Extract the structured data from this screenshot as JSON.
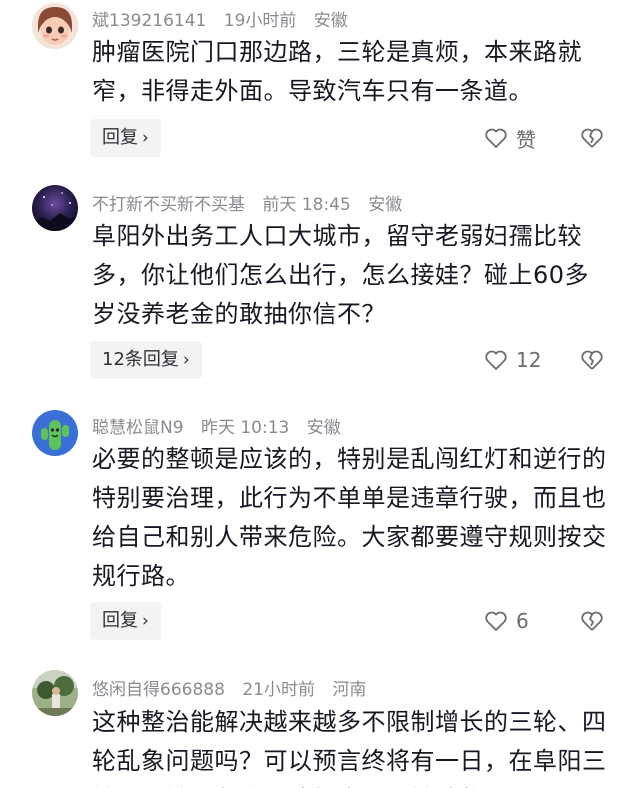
{
  "comments": [
    {
      "username": "斌139216141",
      "time": "19小时前",
      "location": "安徽",
      "text": "肿瘤医院门口那边路，三轮是真烦，本来路就窄，非得走外面。导致汽车只有一条道。",
      "reply_label": "回复",
      "like_label": "赞",
      "avatar_icon": "cartoon-girl-avatar"
    },
    {
      "username": "不打新不买新不买基",
      "time": "前天 18:45",
      "location": "安徽",
      "text": "阜阳外出务工人口大城市，留守老弱妇孺比较多，你让他们怎么出行，怎么接娃？碰上60多岁没养老金的敢抽你信不？",
      "reply_label": "12条回复",
      "like_label": "12",
      "avatar_icon": "night-sky-avatar"
    },
    {
      "username": "聪慧松鼠N9",
      "time": "昨天 10:13",
      "location": "安徽",
      "text": "必要的整顿是应该的，特别是乱闯红灯和逆行的特别要治理，此行为不单单是违章行驶，而且也给自己和别人带来危险。大家都要遵守规则按交规行路。",
      "reply_label": "回复",
      "like_label": "6",
      "avatar_icon": "cactus-avatar"
    },
    {
      "username": "悠闲自得666888",
      "time": "21小时前",
      "location": "河南",
      "text": "这种整治能解决越来越多不限制增长的三轮、四轮乱象问题吗？可以预言终将有一日，在阜阳三轮、四轮乱象会到达如今天三轮被整",
      "avatar_icon": "photo-avatar"
    }
  ],
  "icons": {
    "like": "heart-outline-icon",
    "dislike": "broken-heart-icon",
    "chevron": "chevron-right-icon"
  }
}
